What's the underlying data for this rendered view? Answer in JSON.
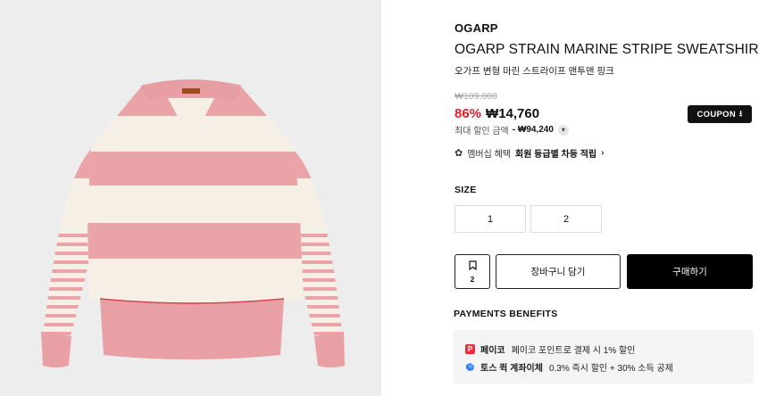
{
  "product": {
    "brand": "OGARP",
    "title": "OGARP STRAIN MARINE STRIPE SWEATSHIRT",
    "subtitle": "오가프 변형 마린 스트라이프 맨투맨 핑크",
    "image_alt": "pink and cream striped sweatshirt"
  },
  "price": {
    "original": "₩109,000",
    "discount": "86%",
    "current": "₩14,760",
    "max_label": "최대 할인 금액",
    "max_value": "- ₩94,240"
  },
  "coupon": {
    "label": "COUPON",
    "icon": "download-icon"
  },
  "membership": {
    "label": "멤버십 혜택",
    "strong": "회원 등급별 차등 적립",
    "arrow": "›"
  },
  "size": {
    "label": "SIZE",
    "options": [
      "1",
      "2"
    ]
  },
  "actions": {
    "wish_count": "2",
    "cart_label": "장바구니 담기",
    "buy_label": "구매하기"
  },
  "payments": {
    "label": "PAYMENTS BENEFITS",
    "items": [
      {
        "icon": "payco-icon",
        "icon_text": "P",
        "name": "페이코",
        "desc": "페이코 포인트로 결제 시 1% 할인",
        "color": "#ea2e3d"
      },
      {
        "icon": "toss-icon",
        "name": "토스 퀵 계좌이체",
        "desc": "0.3% 즉시 할인 + 30% 소득 공제",
        "color": "#3182f6"
      }
    ]
  },
  "colors": {
    "discount": "#e0202c",
    "stripe_pink": "#eaa4a8",
    "stripe_cream": "#f6efe6",
    "background": "#ededed"
  }
}
